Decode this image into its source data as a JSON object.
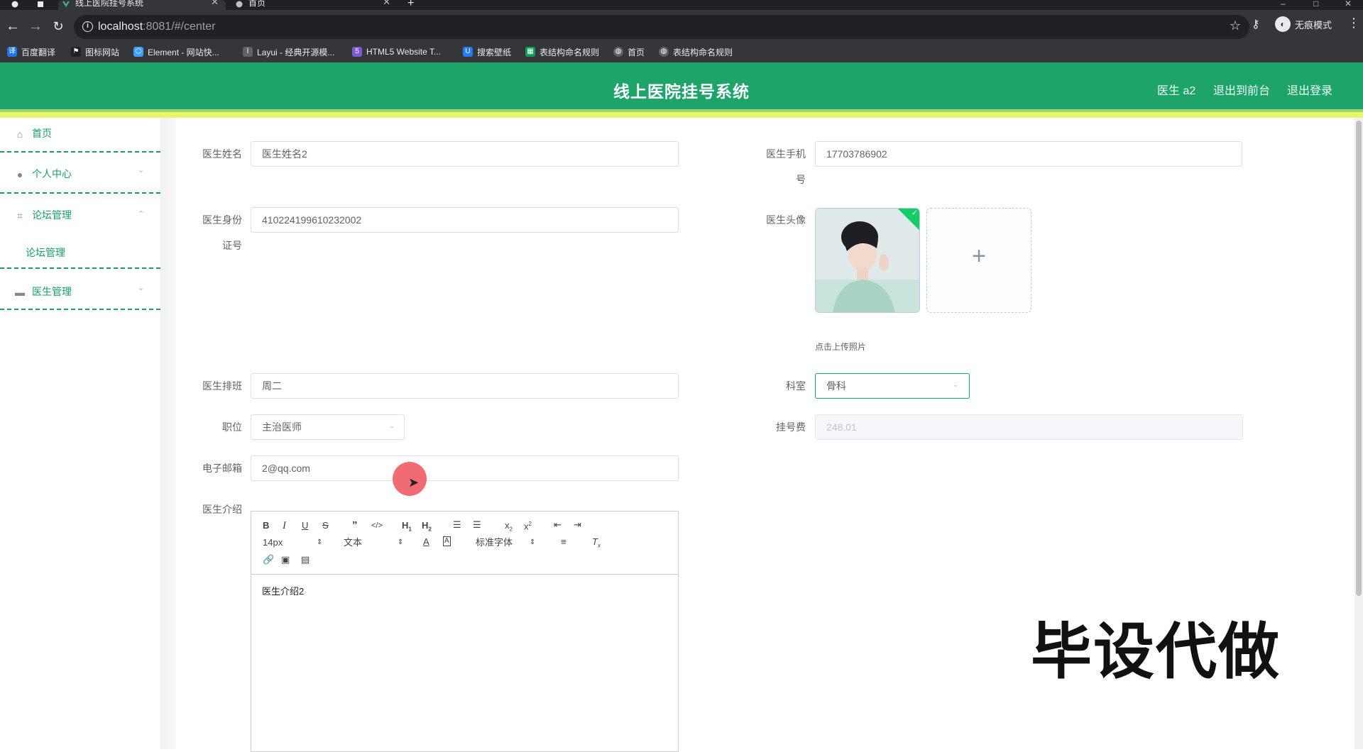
{
  "browser": {
    "tabs": [
      {
        "label": "线上医院挂号系统",
        "active": true
      },
      {
        "label": "首页",
        "active": false
      }
    ],
    "url_host": "localhost",
    "url_path": ":8081/#/center",
    "incognito_label": "无痕模式",
    "bookmarks": [
      {
        "label": "百度翻译",
        "icon": "translate-icon",
        "color": "#1e74e8"
      },
      {
        "label": "图标网站",
        "icon": "flag-icon",
        "color": "#202124"
      },
      {
        "label": "Element - 网站快...",
        "icon": "element-icon",
        "color": "#409eff"
      },
      {
        "label": "Layui - 经典开源模...",
        "icon": "layui-icon",
        "color": "#5f6368"
      },
      {
        "label": "HTML5 Website T...",
        "icon": "html5-icon",
        "color": "#7b5cd6"
      },
      {
        "label": "搜索壁纸",
        "icon": "wallpaper-icon",
        "color": "#2979ff"
      },
      {
        "label": "表结构命名规则",
        "icon": "sheet-icon",
        "color": "#0f9d58"
      },
      {
        "label": "首页",
        "icon": "globe-icon",
        "color": "#5f6368"
      },
      {
        "label": "表结构命名规则",
        "icon": "globe-icon",
        "color": "#5f6368"
      }
    ]
  },
  "header": {
    "title": "线上医院挂号系统",
    "user": "医生 a2",
    "to_front": "退出到前台",
    "logout": "退出登录"
  },
  "sidebar": {
    "items": [
      {
        "label": "首页",
        "icon": "home-icon"
      },
      {
        "label": "个人中心",
        "icon": "user-icon"
      },
      {
        "label": "论坛管理",
        "icon": "crop-icon"
      },
      {
        "label": "医生管理",
        "icon": "ticket-icon"
      }
    ],
    "sub_forum": "论坛管理"
  },
  "form": {
    "name_label": "医生姓名",
    "name_value": "医生姓名2",
    "phone_label_1": "医生手机",
    "phone_label_2": "号",
    "phone_value": "17703786902",
    "idcard_label_1": "医生身份",
    "idcard_label_2": "证号",
    "idcard_value": "410224199610232002",
    "avatar_label": "医生头像",
    "upload_tip": "点击上传照片",
    "schedule_label": "医生排班",
    "schedule_value": "周二",
    "dept_label": "科室",
    "dept_value": "骨科",
    "position_label": "职位",
    "position_value": "主治医师",
    "fee_label": "挂号费",
    "fee_value": "248.01",
    "email_label": "电子邮箱",
    "email_value": "2@qq.com",
    "intro_label": "医生介绍",
    "intro_value": "医生介绍2"
  },
  "editor": {
    "font_size": "14px",
    "block_type": "文本",
    "font_family": "标准字体"
  },
  "watermark": "毕设代做"
}
